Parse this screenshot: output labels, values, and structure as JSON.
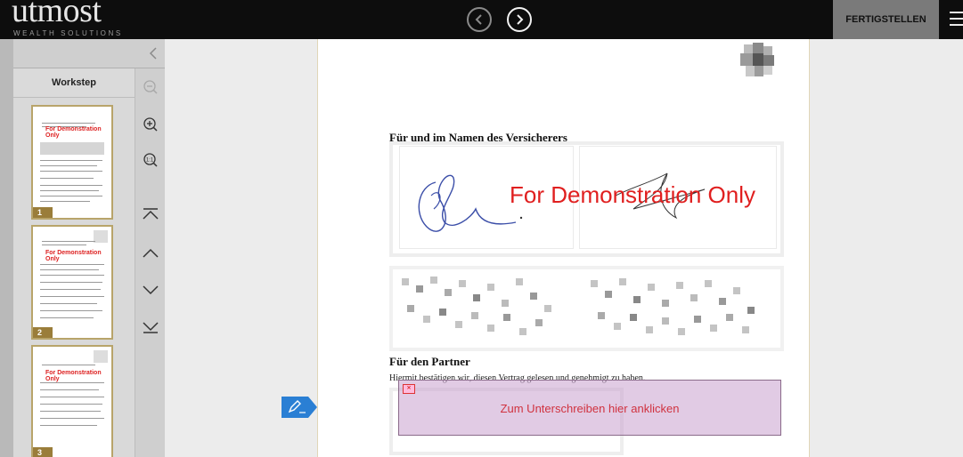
{
  "header": {
    "logo_main": "utmost",
    "logo_sub": "WEALTH SOLUTIONS",
    "finish_label": "FERTIGSTELLEN",
    "prev_icon": "chevron-left-circle-icon",
    "next_icon": "chevron-right-circle-icon",
    "menu_icon": "hamburger-menu-icon"
  },
  "sidebar": {
    "collapse_icon": "chevron-left-icon",
    "workstep_label": "Workstep",
    "thumbnails": [
      {
        "page": "1",
        "demo_text": "For Demonstration Only"
      },
      {
        "page": "2",
        "demo_text": "For Demonstration Only"
      },
      {
        "page": "3",
        "demo_text": "For Demonstration Only"
      }
    ],
    "tools": [
      "zoom-out-icon",
      "zoom-in-icon",
      "zoom-actual-size-icon",
      "first-page-icon",
      "previous-page-icon",
      "next-page-icon",
      "last-page-icon"
    ]
  },
  "document": {
    "insurer_heading": "Für und im Namen des Versicherers",
    "watermark": "For Demonstration Only",
    "partner_heading": "Für den Partner",
    "partner_text": "Hiermit bestätigen wir, diesen Vertrag gelesen und genehmigt zu haben.",
    "sign_field_label": "Zum Unterschreiben hier anklicken",
    "sign_icon": "pen-sign-icon"
  },
  "colors": {
    "topbar": "#0d0d0d",
    "finish_button": "#7a7a7a",
    "watermark": "#e01f1f",
    "sign_field": "#d7b6d9",
    "sign_label": "#d0323f",
    "thumb_border": "#b8a46a",
    "sign_arrow": "#2a7fd4"
  }
}
